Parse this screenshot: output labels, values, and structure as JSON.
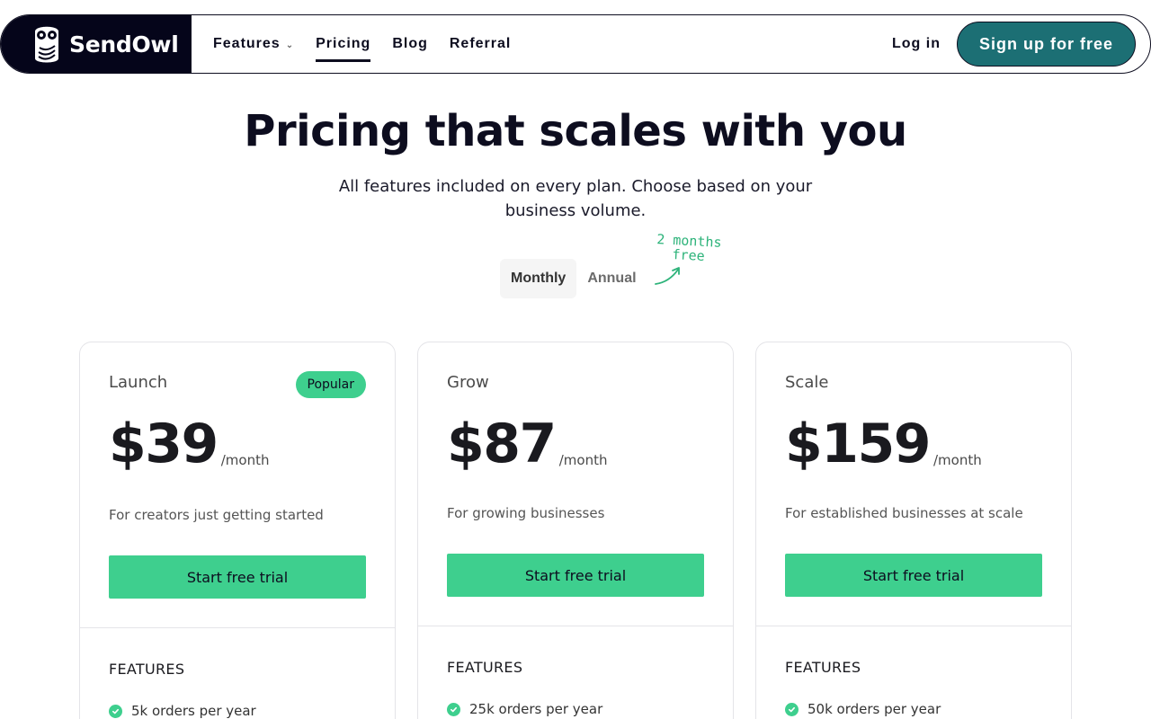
{
  "nav": {
    "brand": "SendOwl",
    "links": [
      {
        "label": "Features",
        "dropdown": true
      },
      {
        "label": "Pricing",
        "active": true
      },
      {
        "label": "Blog"
      },
      {
        "label": "Referral"
      }
    ],
    "login": "Log in",
    "signup": "Sign up for free"
  },
  "hero": {
    "title": "Pricing that scales with you",
    "subtitle": "All features included on every plan. Choose based on your business volume."
  },
  "billing_toggle": {
    "options": [
      "Monthly",
      "Annual"
    ],
    "selected": "Monthly",
    "promo_line1": "2 months",
    "promo_line2": "free"
  },
  "plans": [
    {
      "name": "Launch",
      "badge": "Popular",
      "price": "$39",
      "period": "/month",
      "description": "For creators just getting started",
      "cta": "Start free trial",
      "features_heading": "FEATURES",
      "features": [
        "5k orders per year"
      ]
    },
    {
      "name": "Grow",
      "price": "$87",
      "period": "/month",
      "description": "For growing businesses",
      "cta": "Start free trial",
      "features_heading": "FEATURES",
      "features": [
        "25k orders per year"
      ]
    },
    {
      "name": "Scale",
      "price": "$159",
      "period": "/month",
      "description": "For established businesses at scale",
      "cta": "Start free trial",
      "features_heading": "FEATURES",
      "features": [
        "50k orders per year"
      ]
    }
  ],
  "colors": {
    "brand_dark": "#05051a",
    "accent_teal": "#1c6f74",
    "cta_green": "#3ecf8e",
    "promo_green": "#2db37a"
  },
  "icons": [
    "owl-logo-icon",
    "chevron-down-icon",
    "check-circle-icon",
    "curved-arrow-icon"
  ]
}
